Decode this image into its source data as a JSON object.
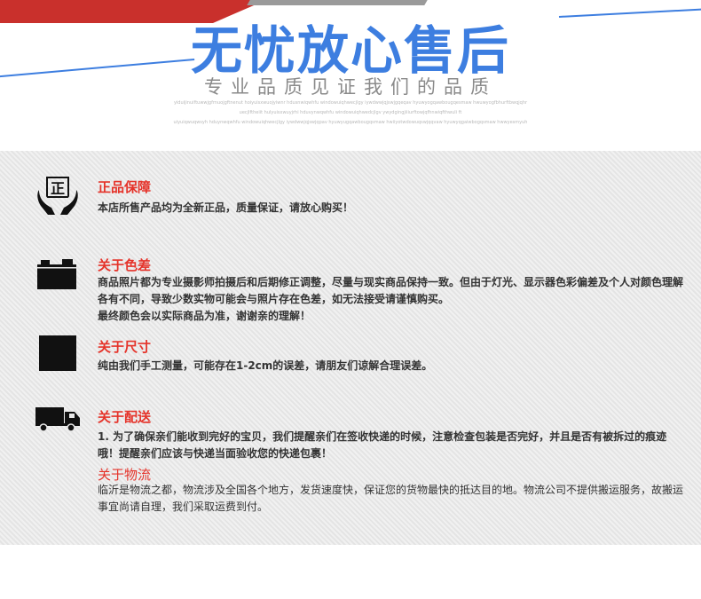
{
  "header": {
    "title": "无忧放心售后",
    "subtitle": "专业品质见证我们的品质",
    "tiny_lines": [
      "yiduijinuiftuwwjgfrnuojgftnenut hoiyuisxwuojyiwnr hdusnwiqwhfu windowuiqhwecjlgy iywdwwjqjswjgqeqav hyuwyogqawbougqesmaw hwuwyogfbhurftbwqjqhr",
      "uecjlftheiit hulyuisxwuyjrhi hduvynwqwhfu windowuiqhwedcjlgv ywydgingjiiiurftowjqfhnwiqfthwuli ft",
      "uiyuiqwuqwsyh hduynwqwhfu windowuiqhwecjlgy iywdwwjqjswjqpav hyuwyugqawbougqsmaw hwiiyotwdowuqswjqqvaw hyuwyqgaiwbogqsmaw hwwyesmyuh"
    ],
    "colors": {
      "title_blue": "#3d7ee0",
      "accent_red": "#e5332a"
    }
  },
  "sections": [
    {
      "icon": "genuine-hands-icon",
      "icon_char": "正",
      "title": "正品保障",
      "body": [
        "本店所售产品均为全新正品，质量保证，请放心购买！"
      ]
    },
    {
      "icon": "camera-icon",
      "title": "关于色差",
      "body": [
        "商品照片都为专业摄影师拍摄后和后期修正调整，尽量与现实商品保持一致。但由于灯光、显示器色彩偏差及个人对颜色理解各有不同，导致少数实物可能会与照片存在色差，如无法接受请谨慎购买。",
        "最终颜色会以实际商品为准，谢谢亲的理解！"
      ]
    },
    {
      "icon": "square-size-icon",
      "title": "关于尺寸",
      "body": [
        "纯由我们手工测量，可能存在1-2cm的误差，请朋友们谅解合理误差。"
      ]
    },
    {
      "icon": "truck-icon",
      "title": "关于配送",
      "body": [
        "1. 为了确保亲们能收到完好的宝贝，我们提醒亲们在签收快递的时候，注意检查包装是否完好，并且是否有被拆过的痕迹哦！提醒亲们应该与快递当面验收您的快递包裹！"
      ]
    },
    {
      "title": "关于物流",
      "body": [
        "临沂是物流之都，物流涉及全国各个地方，发货速度快，保证您的货物最快的抵达目的地。物流公司不提供搬运服务，故搬运事宜尚请自理，我们采取运费到付。"
      ]
    }
  ]
}
